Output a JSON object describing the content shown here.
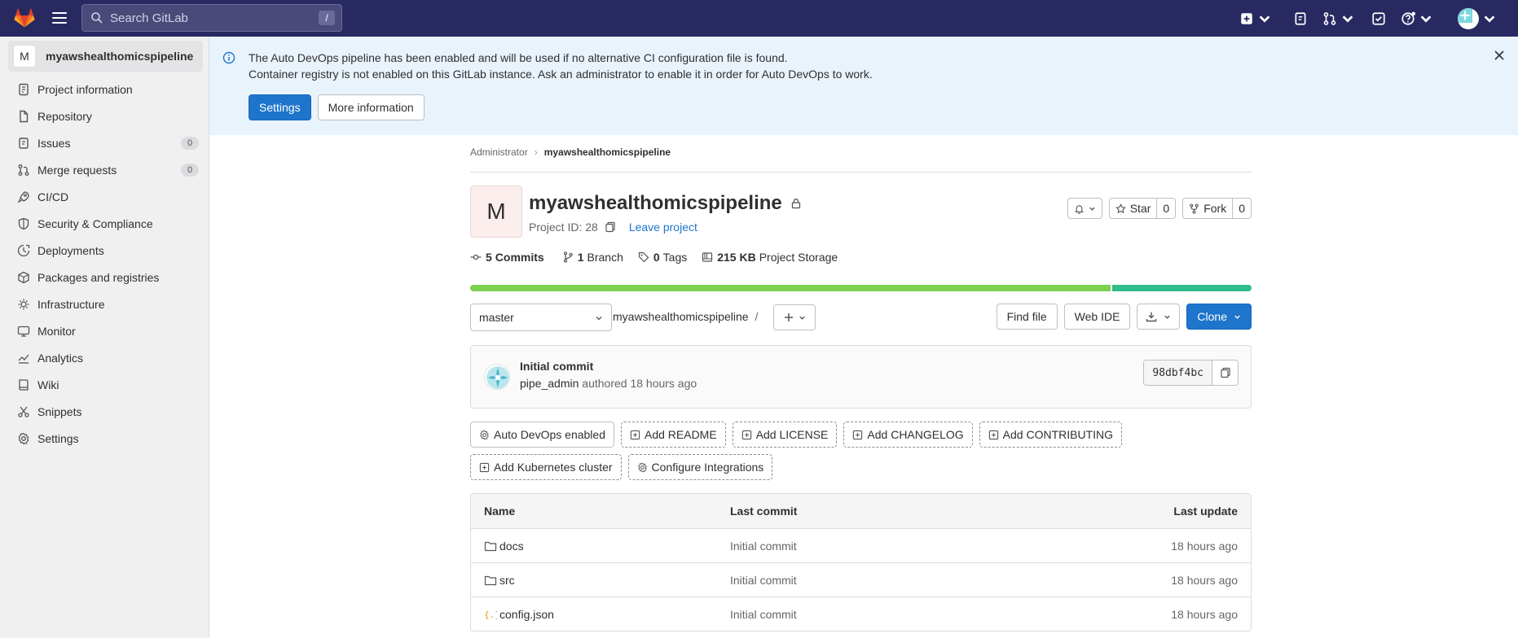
{
  "topbar": {
    "search_placeholder": "Search GitLab",
    "search_shortcut": "/",
    "accent": "#292961"
  },
  "sidebar": {
    "project_initial": "M",
    "project_name": "myawshealthomicspipeline",
    "items": [
      {
        "label": "Project information",
        "icon": "info-doc-icon"
      },
      {
        "label": "Repository",
        "icon": "doc-icon"
      },
      {
        "label": "Issues",
        "icon": "issues-icon",
        "count": "0"
      },
      {
        "label": "Merge requests",
        "icon": "merge-request-icon",
        "count": "0"
      },
      {
        "label": "CI/CD",
        "icon": "rocket-icon"
      },
      {
        "label": "Security & Compliance",
        "icon": "shield-icon"
      },
      {
        "label": "Deployments",
        "icon": "deployments-icon"
      },
      {
        "label": "Packages and registries",
        "icon": "package-icon"
      },
      {
        "label": "Infrastructure",
        "icon": "cloud-gear-icon"
      },
      {
        "label": "Monitor",
        "icon": "monitor-icon"
      },
      {
        "label": "Analytics",
        "icon": "chart-icon"
      },
      {
        "label": "Wiki",
        "icon": "book-icon"
      },
      {
        "label": "Snippets",
        "icon": "snippet-icon"
      },
      {
        "label": "Settings",
        "icon": "settings-icon"
      }
    ]
  },
  "alert": {
    "line1": "The Auto DevOps pipeline has been enabled and will be used if no alternative CI configuration file is found.",
    "line2": "Container registry is not enabled on this GitLab instance. Ask an administrator to enable it in order for Auto DevOps to work.",
    "settings_label": "Settings",
    "more_info_label": "More information"
  },
  "breadcrumb": {
    "parent": "Administrator",
    "current": "myawshealthomicspipeline"
  },
  "project": {
    "initial": "M",
    "name": "myawshealthomicspipeline",
    "id_label": "Project ID: 28",
    "leave_label": "Leave project",
    "star_label": "Star",
    "star_count": "0",
    "fork_label": "Fork",
    "fork_count": "0"
  },
  "stats": {
    "commits_count": "5",
    "commits_label": "Commits",
    "branch_count": "1",
    "branch_label": "Branch",
    "tags_count": "0",
    "tags_label": "Tags",
    "storage_size": "215 KB",
    "storage_label": "Project Storage"
  },
  "languages": [
    {
      "color": "#7cd151",
      "fraction": 0.82
    },
    {
      "color": "#2fbd8a",
      "fraction": 0.18
    }
  ],
  "repo_toolbar": {
    "branch": "master",
    "path": "myawshealthomicspipeline",
    "path_sep": "/",
    "find_file": "Find file",
    "web_ide": "Web IDE",
    "clone": "Clone"
  },
  "last_commit": {
    "title": "Initial commit",
    "author": "pipe_admin",
    "meta": "authored 18 hours ago",
    "sha": "98dbf4bc"
  },
  "shortcuts": [
    {
      "label": "Auto DevOps enabled",
      "icon": "settings-icon",
      "style": "solid"
    },
    {
      "label": "Add README",
      "icon": "plus-square-icon",
      "style": "dashed"
    },
    {
      "label": "Add LICENSE",
      "icon": "plus-square-icon",
      "style": "dashed"
    },
    {
      "label": "Add CHANGELOG",
      "icon": "plus-square-icon",
      "style": "dashed"
    },
    {
      "label": "Add CONTRIBUTING",
      "icon": "plus-square-icon",
      "style": "dashed"
    },
    {
      "label": "Add Kubernetes cluster",
      "icon": "plus-square-icon",
      "style": "dashed"
    },
    {
      "label": "Configure Integrations",
      "icon": "settings-icon",
      "style": "dashed"
    }
  ],
  "file_table": {
    "headers": {
      "name": "Name",
      "last_commit": "Last commit",
      "last_update": "Last update"
    },
    "rows": [
      {
        "name": "docs",
        "type": "folder",
        "commit": "Initial commit",
        "updated": "18 hours ago"
      },
      {
        "name": "src",
        "type": "folder",
        "commit": "Initial commit",
        "updated": "18 hours ago"
      },
      {
        "name": "config.json",
        "type": "json",
        "commit": "Initial commit",
        "updated": "18 hours ago"
      }
    ]
  }
}
